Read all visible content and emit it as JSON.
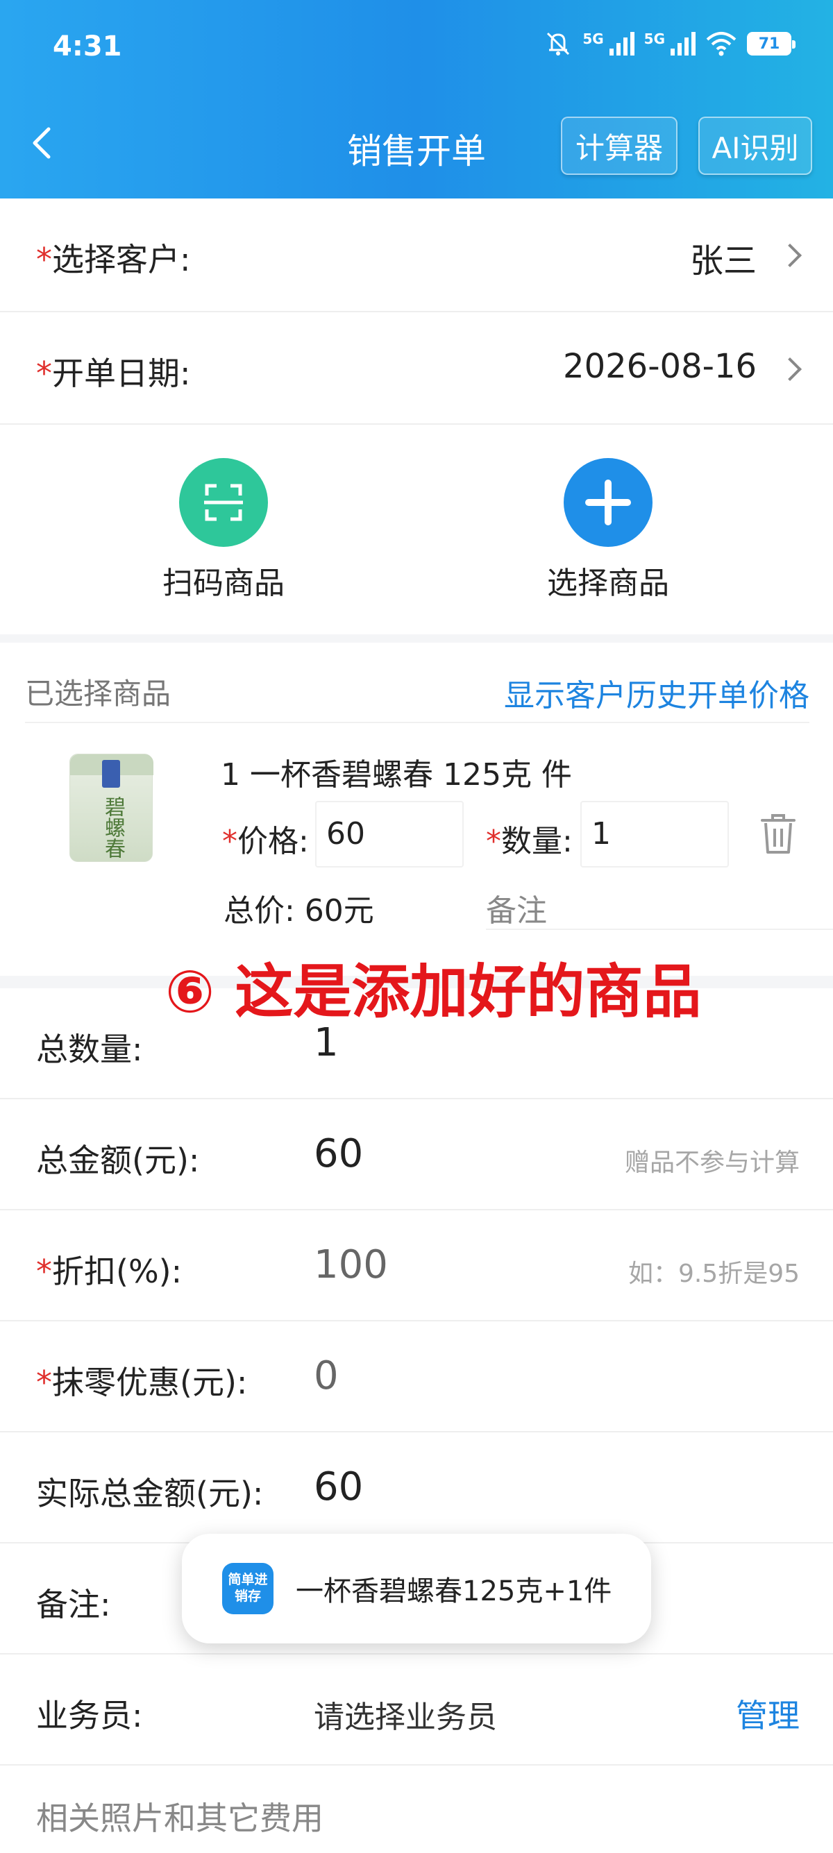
{
  "status_bar": {
    "time": "4:31",
    "network_a": "5G",
    "network_b": "5G",
    "battery": "71"
  },
  "header": {
    "title": "销售开单",
    "calculator_label": "计算器",
    "ai_label": "AI识别"
  },
  "customer": {
    "required_mark": "*",
    "label": "选择客户:",
    "value": "张三"
  },
  "order_date": {
    "required_mark": "*",
    "label": "开单日期:",
    "value": "2026-08-16"
  },
  "actions": {
    "scan_label": "扫码商品",
    "select_label": "选择商品"
  },
  "goods": {
    "section_title": "已选择商品",
    "history_link": "显示客户历史开单价格",
    "item": {
      "name": "1 一杯香碧螺春 125克 件",
      "price_label": "价格:",
      "price": "60",
      "qty_label": "数量:",
      "qty": "1",
      "total": "总价: 60元",
      "remark_placeholder": "备注",
      "required_mark": "*"
    }
  },
  "annotation": "⑥ 这是添加好的商品",
  "summary": {
    "total_qty_label": "总数量:",
    "total_qty": "1",
    "total_amount_label": "总金额(元):",
    "total_amount": "60",
    "total_amount_hint": "赠品不参与计算",
    "discount_label": "折扣(%):",
    "discount": "100",
    "discount_hint": "如：9.5折是95",
    "rounding_label": "抹零优惠(元):",
    "rounding": "0",
    "actual_label": "实际总金额(元):",
    "actual": "60",
    "note_label": "备注:",
    "salesman_label": "业务员:",
    "salesman_placeholder": "请选择业务员",
    "manage_label": "管理",
    "photos_label": "相关照片和其它费用",
    "required_mark": "*"
  },
  "toast": {
    "app_icon_text": "简单进销存",
    "message": "一杯香碧螺春125克+1件"
  },
  "colors": {
    "brand_blue": "#1f8fe8",
    "scan_green": "#2ec79a",
    "required_red": "#e0302d",
    "annotation_red": "#e4171b"
  },
  "icons": [
    "back-arrow-icon",
    "chevron-right-icon",
    "scan-icon",
    "plus-icon",
    "trash-icon"
  ]
}
